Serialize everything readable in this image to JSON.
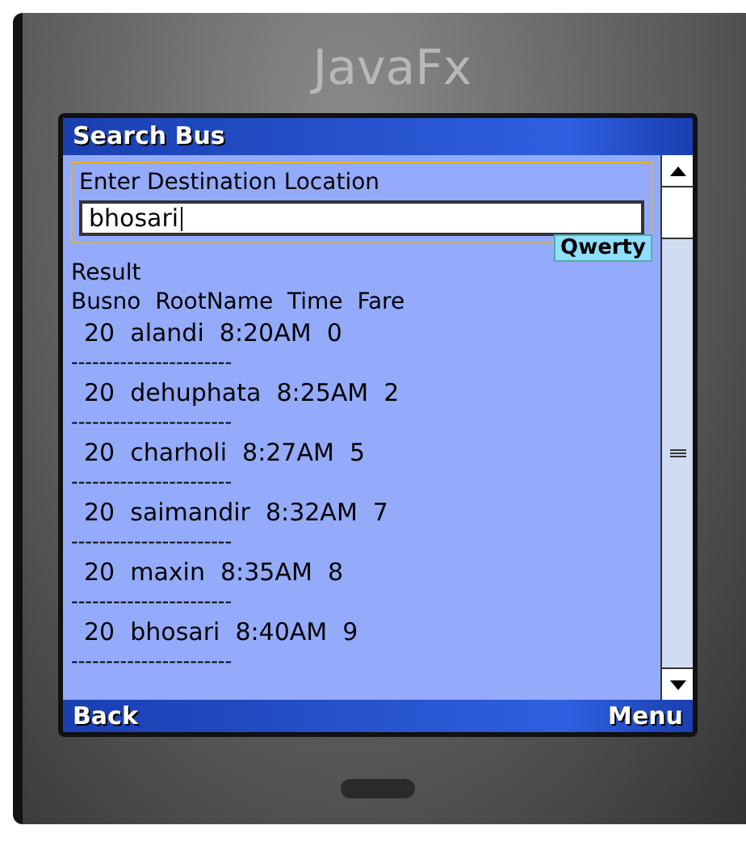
{
  "logo": "JavaFx",
  "screen": {
    "title": "Search Bus",
    "field_label": "Enter Destination Location",
    "search_field": {
      "value": "bhosari"
    },
    "input_mode": "Qwerty",
    "result_label": "Result",
    "header": "Busno  RootName  Time  Fare",
    "results": [
      {
        "text": "20  alandi  8:20AM  0",
        "separator": "-----------------------"
      },
      {
        "text": "20  dehuphata  8:25AM  2",
        "separator": "-----------------------"
      },
      {
        "text": "20  charholi  8:27AM  5",
        "separator": "-----------------------"
      },
      {
        "text": "20  saimandir  8:32AM  7",
        "separator": "-----------------------"
      },
      {
        "text": "20  maxin  8:35AM  8",
        "separator": "-----------------------"
      },
      {
        "text": "20  bhosari  8:40AM  9",
        "separator": "-----------------------"
      }
    ],
    "softkeys": {
      "left": "Back",
      "right": "Menu"
    }
  }
}
